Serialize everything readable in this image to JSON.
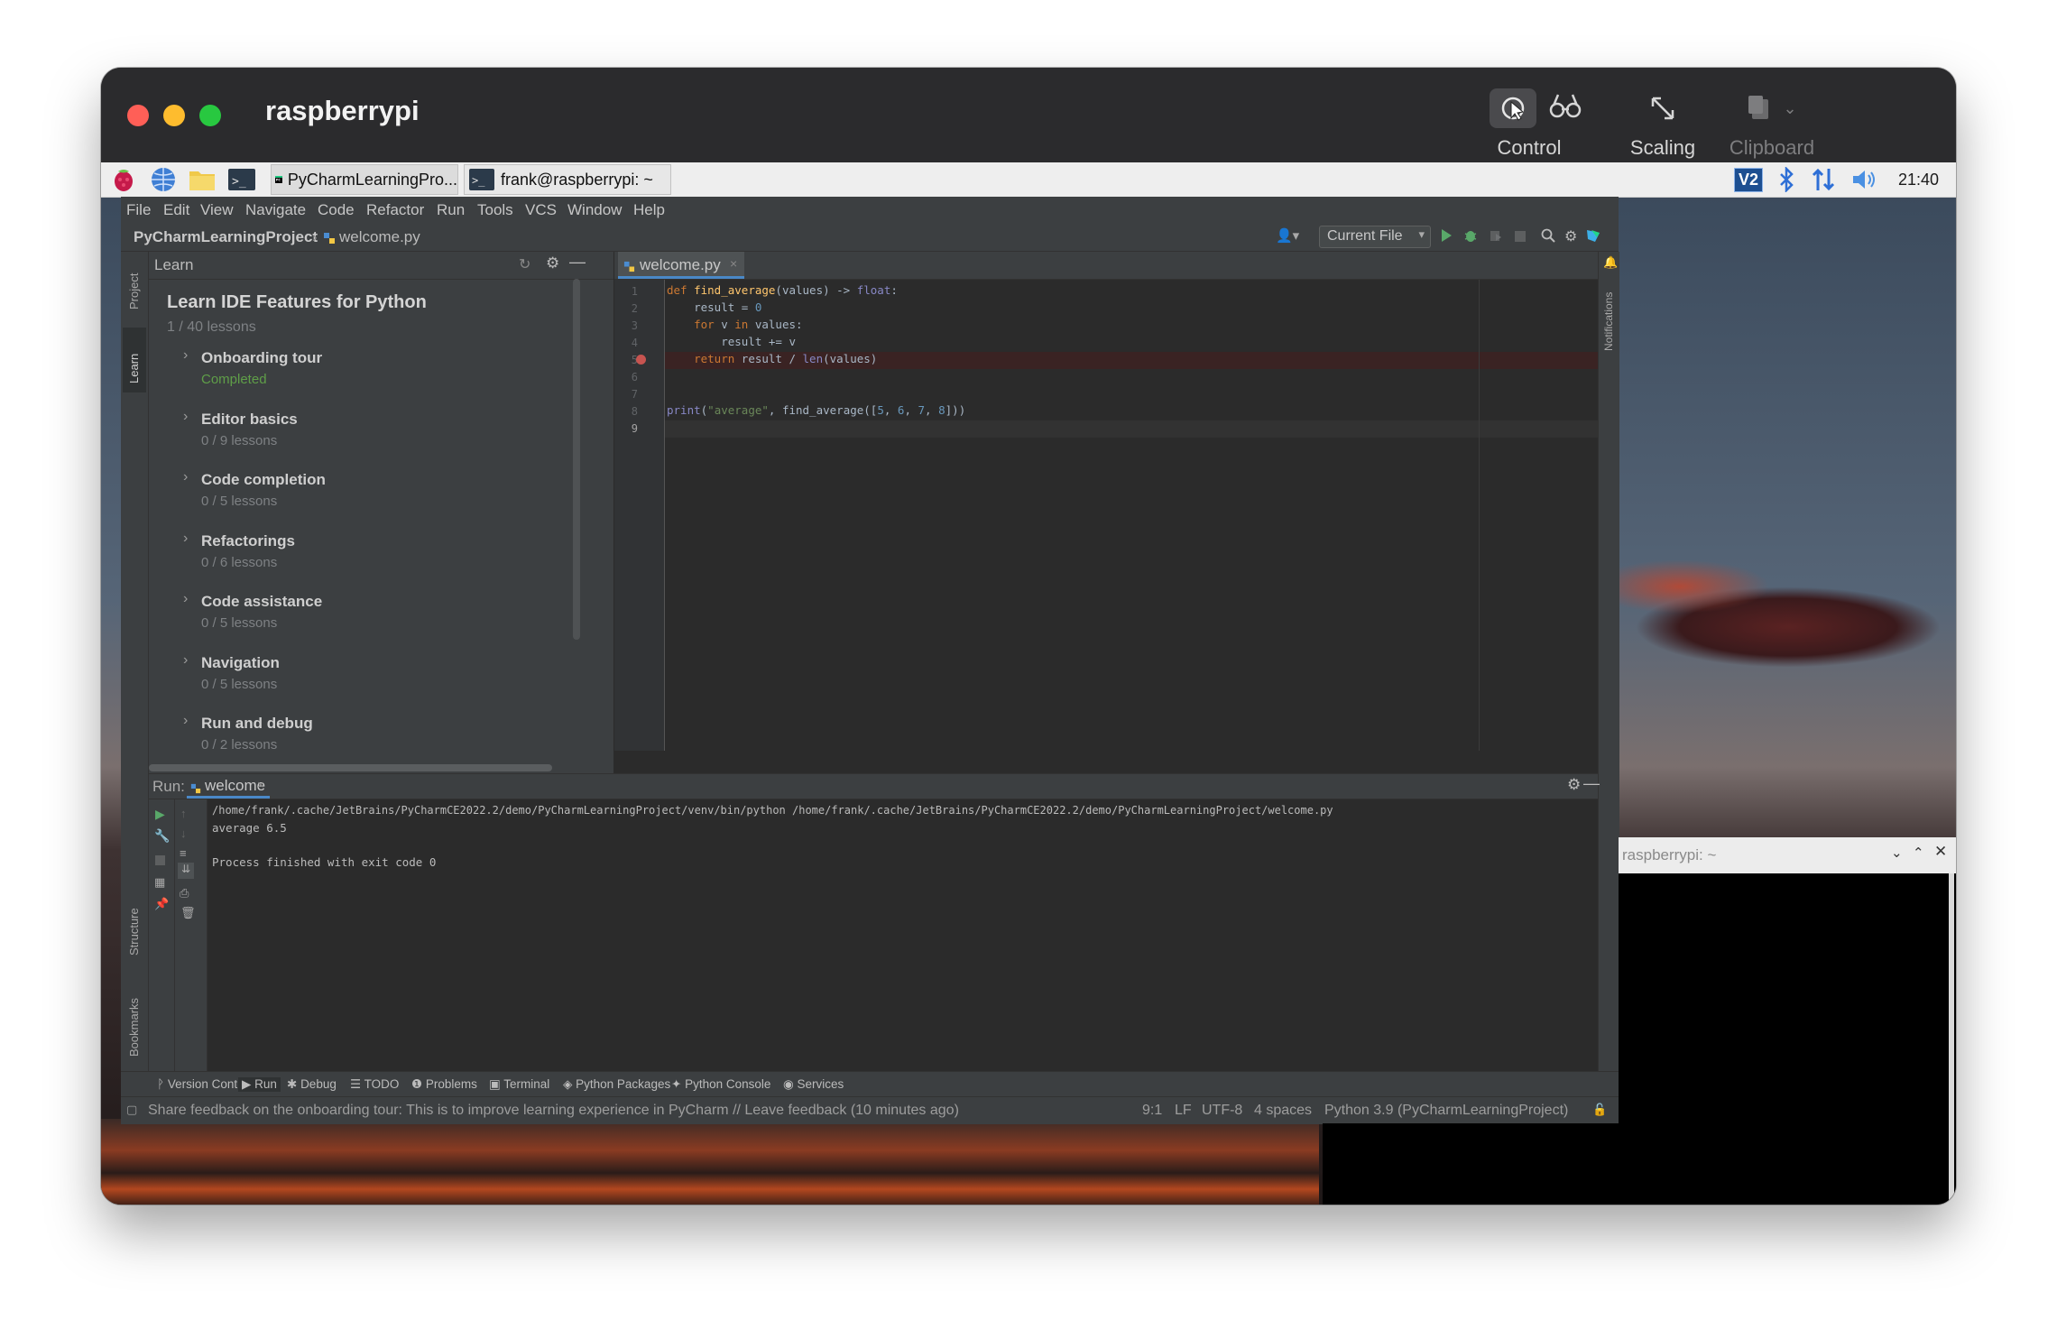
{
  "window": {
    "title": "raspberrypi",
    "controls": {
      "close": "#ff5f57",
      "minimize": "#febc2e",
      "maximize": "#28c840"
    }
  },
  "toolbar": {
    "control_label": "Control",
    "scaling_label": "Scaling",
    "clipboard_label": "Clipboard"
  },
  "taskbar": {
    "apps": [
      {
        "label": "PyCharmLearningPro..."
      },
      {
        "label": "frank@raspberrypi: ~"
      }
    ],
    "clock": "21:40"
  },
  "ide": {
    "menu": [
      "File",
      "Edit",
      "View",
      "Navigate",
      "Code",
      "Refactor",
      "Run",
      "Tools",
      "VCS",
      "Window",
      "Help"
    ],
    "breadcrumb": {
      "project": "PyCharmLearningProject",
      "file": "welcome.py"
    },
    "run_config": "Current File",
    "left_stripe": {
      "project": "Project",
      "learn": "Learn",
      "structure": "Structure",
      "bookmarks": "Bookmarks"
    },
    "learn": {
      "header": "Learn",
      "title": "Learn IDE Features for Python",
      "progress": "1 / 40 lessons",
      "lessons": [
        {
          "title": "Onboarding tour",
          "status": "Completed"
        },
        {
          "title": "Editor basics",
          "status": "0 / 9 lessons"
        },
        {
          "title": "Code completion",
          "status": "0 / 5 lessons"
        },
        {
          "title": "Refactorings",
          "status": "0 / 6 lessons"
        },
        {
          "title": "Code assistance",
          "status": "0 / 5 lessons"
        },
        {
          "title": "Navigation",
          "status": "0 / 5 lessons"
        },
        {
          "title": "Run and debug",
          "status": "0 / 2 lessons"
        }
      ]
    },
    "editor": {
      "tab": "welcome.py",
      "line_numbers": [
        "1",
        "2",
        "3",
        "4",
        "5",
        "6",
        "7",
        "8",
        "9"
      ],
      "notifications_label": "Notifications"
    },
    "run": {
      "label": "Run:",
      "tab": "welcome",
      "output": [
        "/home/frank/.cache/JetBrains/PyCharmCE2022.2/demo/PyCharmLearningProject/venv/bin/python /home/frank/.cache/JetBrains/PyCharmCE2022.2/demo/PyCharmLearningProject/welcome.py",
        "average 6.5",
        "",
        "Process finished with exit code 0"
      ]
    },
    "bottom_tabs": [
      "Version Control",
      "Run",
      "Debug",
      "TODO",
      "Problems",
      "Terminal",
      "Python Packages",
      "Python Console",
      "Services"
    ],
    "status": {
      "message": "Share feedback on the onboarding tour: This is to improve learning experience in PyCharm // Leave feedback (10 minutes ago)",
      "position": "9:1",
      "line_sep": "LF",
      "encoding": "UTF-8",
      "indent": "4 spaces",
      "interpreter": "Python 3.9 (PyCharmLearningProject)"
    }
  },
  "terminal": {
    "title": "raspberrypi: ~"
  },
  "colors": {
    "ide_bg": "#2b2b2b",
    "ide_panel": "#3c3f41",
    "completed": "#5f9e48",
    "breakpoint": "#c75450"
  }
}
